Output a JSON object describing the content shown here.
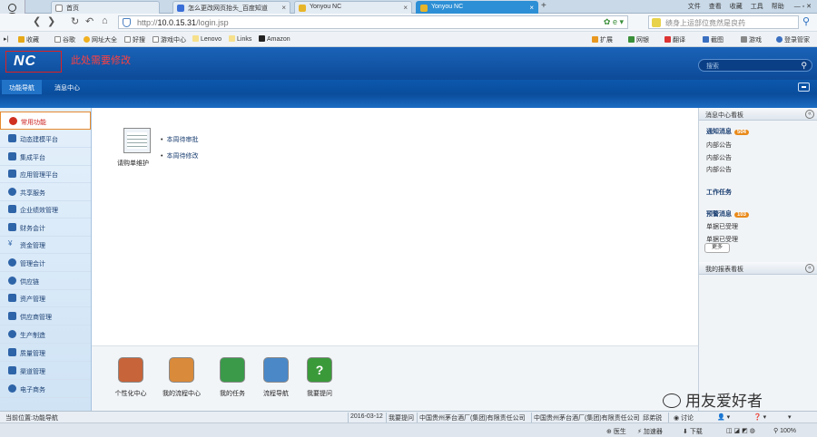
{
  "browser": {
    "tabs": [
      {
        "label": "首页",
        "color": "#ffffff"
      },
      {
        "label": "怎么更改网页抬头_百度知道",
        "color": "#3b6fd8"
      },
      {
        "label": "Yonyou NC",
        "color": "#e7b52a"
      },
      {
        "label": "Yonyou NC",
        "color": "#e7b52a",
        "active": true
      }
    ],
    "window_menu": [
      "文件",
      "查看",
      "收藏",
      "工具",
      "帮助"
    ],
    "url_prefix": "http://",
    "url_host": "10.0.15.31",
    "url_path": "/login.jsp",
    "search_placeholder": "绩身上运部位竟然是良药",
    "bookmarks": [
      "收藏",
      "谷歌",
      "网址大全",
      "好搜",
      "游戏中心",
      "Lenovo",
      "Links",
      "Amazon",
      "扩展",
      "网银",
      "翻译",
      "截图",
      "游戏",
      "登录管家"
    ]
  },
  "nc": {
    "logo": "NC",
    "note": "此处需要修改",
    "search_placeholder": "搜索",
    "nav": [
      "功能导航",
      "消息中心"
    ]
  },
  "sidebar": {
    "items": [
      {
        "label": "常用功能",
        "active": true
      },
      {
        "label": "动态建模平台"
      },
      {
        "label": "集成平台"
      },
      {
        "label": "应用管理平台"
      },
      {
        "label": "共享服务"
      },
      {
        "label": "企业绩效管理"
      },
      {
        "label": "财务会计"
      },
      {
        "label": "资金管理"
      },
      {
        "label": "管理会计"
      },
      {
        "label": "供应链"
      },
      {
        "label": "资产管理"
      },
      {
        "label": "供应商管理"
      },
      {
        "label": "生产制造"
      },
      {
        "label": "质量管理"
      },
      {
        "label": "渠道管理"
      },
      {
        "label": "电子商务"
      }
    ]
  },
  "main": {
    "tile_caption": "请购单维护",
    "links": [
      "本周待审批",
      "本周待修改"
    ],
    "quick": [
      {
        "label": "个性化中心",
        "color": "#c7643a"
      },
      {
        "label": "我的流程中心",
        "color": "#d98a3a"
      },
      {
        "label": "我的任务",
        "color": "#3a9a4a"
      },
      {
        "label": "流程导航",
        "color": "#4a88c8"
      },
      {
        "label": "我要提问",
        "color": "#3a9a3a"
      }
    ]
  },
  "right": {
    "header1": "消息中心看板",
    "notice_title": "通知消息",
    "notice_count": "504",
    "notice_items": [
      "内部公告",
      "内部公告",
      "内部公告"
    ],
    "work_title": "工作任务",
    "alert_title": "预警消息",
    "alert_count": "103",
    "alert_items": [
      "单据已受理",
      "单据已受理"
    ],
    "more": "更多",
    "header2": "我的报表看板"
  },
  "status": {
    "location": "当前位置:功能导航",
    "date": "2016-03-12",
    "ask": "我要提问",
    "org1": "中国贵州茅台酒厂(集团)有限责任公司",
    "org2": "中国贵州茅台酒厂(集团)有限责任公司",
    "user": "邱弟锐",
    "discuss": "讨论"
  },
  "bottom": {
    "doctor": "医生",
    "accelerator": "加速器",
    "download": "下载",
    "zoom": "100%"
  },
  "watermark": "用友爱好者"
}
